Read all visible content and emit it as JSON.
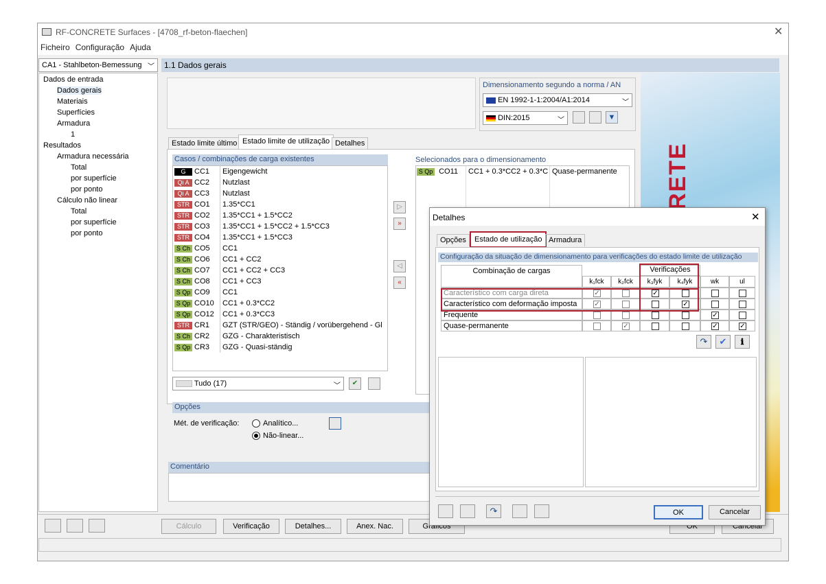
{
  "window": {
    "title": "RF-CONCRETE Surfaces - [4708_rf-beton-flaechen]"
  },
  "menu": [
    "Ficheiro",
    "Configuração",
    "Ajuda"
  ],
  "case_select": "CA1 - Stahlbeton-Bemessung",
  "tree": {
    "items": [
      "Dados de entrada",
      "Dados gerais",
      "Materiais",
      "Superfícies",
      "Armadura",
      "1",
      "Resultados",
      "Armadura necessária",
      "Total",
      "por superfície",
      "por ponto",
      "Cálculo não linear",
      "Total",
      "por superfície",
      "por ponto"
    ]
  },
  "header": {
    "title": "1.1 Dados gerais"
  },
  "norm": {
    "label": "Dimensionamento segundo a norma / AN",
    "code": "EN 1992-1-1:2004/A1:2014",
    "annex": "DIN:2015"
  },
  "tabs": [
    "Estado limite último",
    "Estado limite de utilização",
    "Detalhes"
  ],
  "existing": {
    "label": "Casos / combinações de carga existentes",
    "rows": [
      {
        "tag": "G",
        "cls": "g",
        "id": "CC1",
        "desc": "Eigengewicht"
      },
      {
        "tag": "Qi A",
        "cls": "qi",
        "id": "CC2",
        "desc": "Nutzlast"
      },
      {
        "tag": "Qi A",
        "cls": "qi",
        "id": "CC3",
        "desc": "Nutzlast"
      },
      {
        "tag": "STR",
        "cls": "str",
        "id": "CO1",
        "desc": "1.35*CC1"
      },
      {
        "tag": "STR",
        "cls": "str",
        "id": "CO2",
        "desc": "1.35*CC1 + 1.5*CC2"
      },
      {
        "tag": "STR",
        "cls": "str",
        "id": "CO3",
        "desc": "1.35*CC1 + 1.5*CC2 + 1.5*CC3"
      },
      {
        "tag": "STR",
        "cls": "str",
        "id": "CO4",
        "desc": "1.35*CC1 + 1.5*CC3"
      },
      {
        "tag": "S Ch",
        "cls": "sch",
        "id": "CO5",
        "desc": "CC1"
      },
      {
        "tag": "S Ch",
        "cls": "sch",
        "id": "CO6",
        "desc": "CC1 + CC2"
      },
      {
        "tag": "S Ch",
        "cls": "sch",
        "id": "CO7",
        "desc": "CC1 + CC2 + CC3"
      },
      {
        "tag": "S Ch",
        "cls": "sch",
        "id": "CO8",
        "desc": "CC1 + CC3"
      },
      {
        "tag": "S Qp",
        "cls": "sqp",
        "id": "CO9",
        "desc": "CC1"
      },
      {
        "tag": "S Qp",
        "cls": "sqp",
        "id": "CO10",
        "desc": "CC1 + 0.3*CC2"
      },
      {
        "tag": "S Qp",
        "cls": "sqp",
        "id": "CO12",
        "desc": "CC1 + 0.3*CC3"
      },
      {
        "tag": "STR",
        "cls": "str",
        "id": "CR1",
        "desc": "GZT (STR/GEO) - Ständig / vorübergehend - Gl"
      },
      {
        "tag": "S Ch",
        "cls": "sch",
        "id": "CR2",
        "desc": "GZG - Charakteristisch"
      },
      {
        "tag": "S Qp",
        "cls": "sqp",
        "id": "CR3",
        "desc": "GZG - Quasi-ständig"
      }
    ],
    "filter": "Tudo (17)"
  },
  "selected": {
    "label": "Selecionados para o dimensionamento",
    "row": {
      "tag": "S Qp",
      "id": "CO11",
      "desc": "CC1 + 0.3*CC2 + 0.3*C",
      "type": "Quase-permanente"
    }
  },
  "options": {
    "label": "Opções",
    "method_label": "Mét. de verificação:",
    "analytic": "Analítico...",
    "nonlinear": "Não-linear..."
  },
  "comment": {
    "label": "Comentário"
  },
  "bottom_buttons": [
    "Cálculo",
    "Verificação",
    "Detalhes...",
    "Anex. Nac.",
    "Gráficos",
    "OK",
    "Cancelar"
  ],
  "dialog": {
    "title": "Detalhes",
    "tabs": [
      "Opções",
      "Estado de utilização",
      "Armadura"
    ],
    "group_label": "Configuração da situação de dimensionamento para verificações do estado limite de utilização",
    "col_combo": "Combinação de cargas",
    "col_verif": "Verificações",
    "cols": [
      "k₁fck",
      "k₂fck",
      "k₃fyk",
      "k₄fyk",
      "wk",
      "ul"
    ],
    "rows": [
      {
        "label": "Característico com carga direta",
        "gray": true,
        "vals": [
          1,
          0,
          1,
          0,
          0,
          0
        ]
      },
      {
        "label": "Característico com deformação imposta",
        "gray": false,
        "vals": [
          1,
          0,
          0,
          1,
          0,
          0
        ]
      },
      {
        "label": "Frequente",
        "gray": false,
        "vals": [
          0,
          0,
          0,
          0,
          1,
          0
        ]
      },
      {
        "label": "Quase-permanente",
        "gray": false,
        "vals": [
          0,
          1,
          0,
          0,
          1,
          1
        ]
      }
    ],
    "ok": "OK",
    "cancel": "Cancelar"
  },
  "brand_text": "RETE"
}
